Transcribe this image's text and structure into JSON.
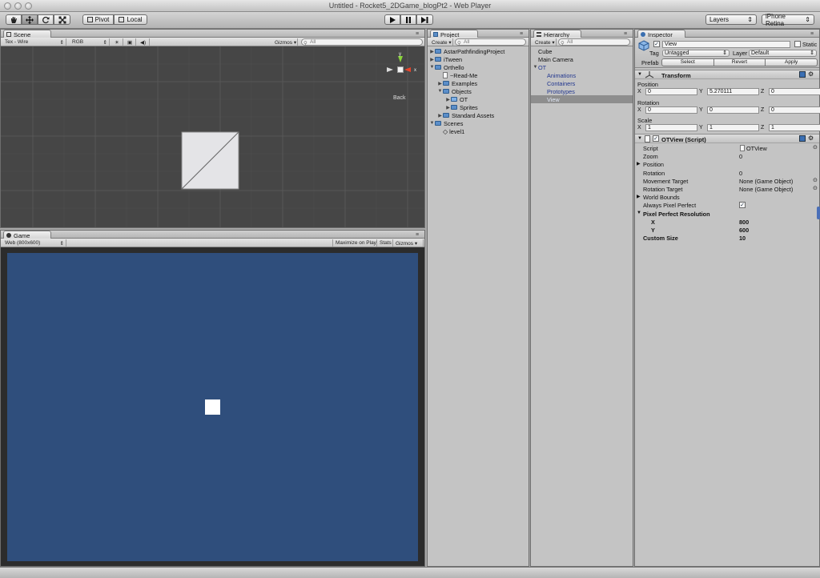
{
  "window": {
    "title": "Untitled - Rocket5_2DGame_blogPt2 - Web Player"
  },
  "toolbar": {
    "tools": [
      {
        "icon": "hand-icon"
      },
      {
        "icon": "move-icon"
      },
      {
        "icon": "rotate-icon"
      },
      {
        "icon": "scale-icon"
      }
    ],
    "pivot_label": "Pivot",
    "local_label": "Local",
    "play_icon": "play-icon",
    "pause_icon": "pause-icon",
    "step_icon": "step-icon",
    "layers_label": "Layers",
    "layout_label": "iPhone Retina"
  },
  "scene": {
    "tab_label": "Scene",
    "render_mode": "Tex - Wire",
    "color_mode": "RGB",
    "gizmos_label": "Gizmos",
    "search_placeholder": "All",
    "gizmo": {
      "y_label": "y",
      "x_label": "x",
      "view_label": "Back"
    }
  },
  "game": {
    "tab_label": "Game",
    "resolution": "Web (800x600)",
    "maximize_label": "Maximize on Play",
    "stats_label": "Stats",
    "gizmos_label": "Gizmos",
    "background_color": "#2f4e7c"
  },
  "project": {
    "tab_label": "Project",
    "create_label": "Create",
    "search_placeholder": "All",
    "items": [
      {
        "label": "AstarPathfindingProject",
        "depth": 0,
        "arrow": "▶",
        "kind": "folder"
      },
      {
        "label": "iTween",
        "depth": 0,
        "arrow": "▶",
        "kind": "folder"
      },
      {
        "label": "Orthello",
        "depth": 0,
        "arrow": "▼",
        "kind": "folder"
      },
      {
        "label": "~Read-Me",
        "depth": 1,
        "arrow": "",
        "kind": "doc"
      },
      {
        "label": "Examples",
        "depth": 1,
        "arrow": "▶",
        "kind": "folder"
      },
      {
        "label": "Objects",
        "depth": 1,
        "arrow": "▼",
        "kind": "folder"
      },
      {
        "label": "OT",
        "depth": 2,
        "arrow": "▶",
        "kind": "prefab"
      },
      {
        "label": "Sprites",
        "depth": 2,
        "arrow": "▶",
        "kind": "folder"
      },
      {
        "label": "Standard Assets",
        "depth": 1,
        "arrow": "▶",
        "kind": "folder"
      },
      {
        "label": "Scenes",
        "depth": 0,
        "arrow": "▼",
        "kind": "folder"
      },
      {
        "label": "level1",
        "depth": 1,
        "arrow": "",
        "kind": "unity"
      }
    ]
  },
  "hierarchy": {
    "tab_label": "Hierarchy",
    "create_label": "Create",
    "search_placeholder": "All",
    "items": [
      {
        "label": "Cube",
        "depth": 0,
        "arrow": "",
        "style": "normal"
      },
      {
        "label": "Main Camera",
        "depth": 0,
        "arrow": "",
        "style": "normal"
      },
      {
        "label": "OT",
        "depth": 0,
        "arrow": "▼",
        "style": "prefab"
      },
      {
        "label": "Animations",
        "depth": 1,
        "arrow": "",
        "style": "prefab"
      },
      {
        "label": "Containers",
        "depth": 1,
        "arrow": "",
        "style": "prefab"
      },
      {
        "label": "Prototypes",
        "depth": 1,
        "arrow": "",
        "style": "prefab"
      },
      {
        "label": "View",
        "depth": 1,
        "arrow": "",
        "style": "selected"
      }
    ]
  },
  "inspector": {
    "tab_label": "Inspector",
    "object_name": "View",
    "static_label": "Static",
    "tag_label": "Tag",
    "tag_value": "Untagged",
    "layer_label": "Layer",
    "layer_value": "Default",
    "prefab_label": "Prefab",
    "prefab_buttons": [
      "Select",
      "Revert",
      "Apply"
    ],
    "transform": {
      "title": "Transform",
      "position_label": "Position",
      "rotation_label": "Rotation",
      "scale_label": "Scale",
      "axes": [
        "X",
        "Y",
        "Z"
      ],
      "position": [
        "0",
        "5.270111",
        "0"
      ],
      "rotation": [
        "0",
        "0",
        "0"
      ],
      "scale": [
        "1",
        "1",
        "1"
      ]
    },
    "script": {
      "title": "OTView (Script)",
      "rows": [
        {
          "label": "Script",
          "value": "OTView",
          "style": "normal",
          "arrow": ""
        },
        {
          "label": "Zoom",
          "value": "0",
          "style": "normal",
          "arrow": ""
        },
        {
          "label": "Position",
          "value": "",
          "style": "normal",
          "arrow": "▶"
        },
        {
          "label": "Rotation",
          "value": "0",
          "style": "normal",
          "arrow": ""
        },
        {
          "label": "Movement Target",
          "value": "None (Game Object)",
          "style": "normal",
          "arrow": ""
        },
        {
          "label": "Rotation Target",
          "value": "None (Game Object)",
          "style": "normal",
          "arrow": ""
        },
        {
          "label": "World Bounds",
          "value": "",
          "style": "normal",
          "arrow": "▶"
        },
        {
          "label": "Always Pixel Perfect",
          "value": "",
          "style": "normal",
          "arrow": ""
        },
        {
          "label": "Pixel Perfect Resolution",
          "value": "",
          "style": "bold",
          "arrow": "▼"
        },
        {
          "label": "X",
          "value": "800",
          "style": "bold-indent",
          "arrow": ""
        },
        {
          "label": "Y",
          "value": "600",
          "style": "bold-indent",
          "arrow": ""
        },
        {
          "label": "Custom Size",
          "value": "10",
          "style": "bold",
          "arrow": ""
        }
      ]
    }
  }
}
